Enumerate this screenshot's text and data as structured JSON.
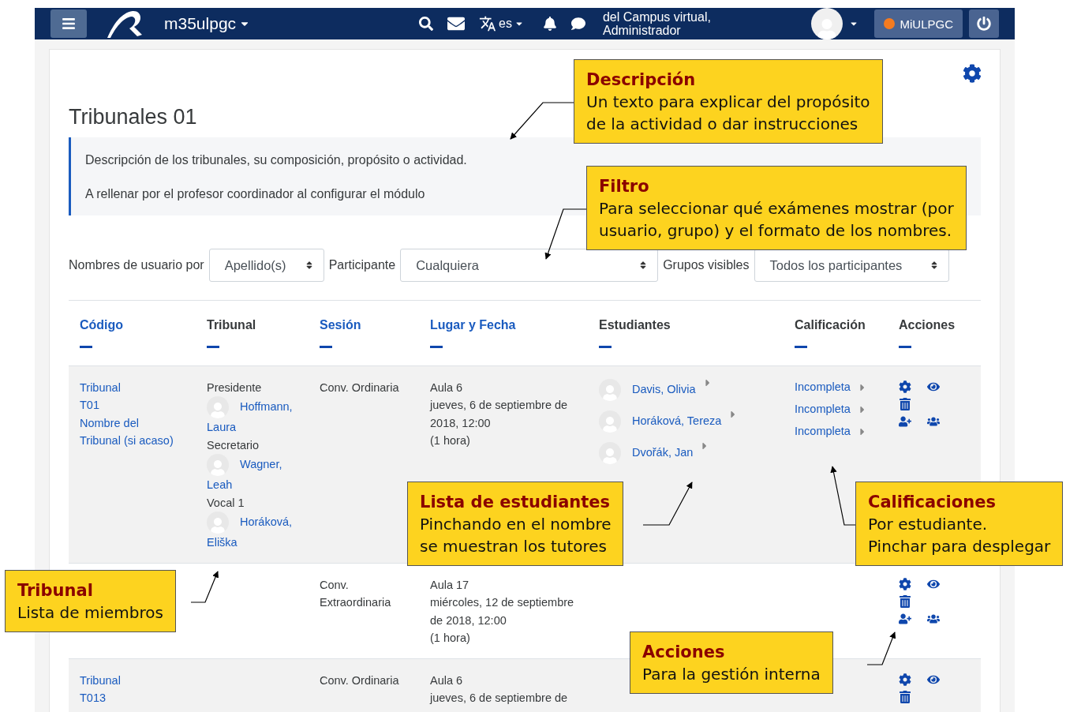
{
  "navbar": {
    "site_name": "m35ulpgc",
    "language": "es",
    "user_lines": [
      "del Campus virtual,",
      "Administrador"
    ],
    "portal_button": "MiULPGC"
  },
  "page": {
    "title": "Tribunales 01",
    "description": [
      "Descripción de los tribunales, su composición, propósito o actividad.",
      "A rellenar por el profesor coordinador al configurar el módulo"
    ]
  },
  "filters": [
    {
      "label": "Nombres de usuario por",
      "value": "Apellido(s)"
    },
    {
      "label": "Participante",
      "value": "Cualquiera"
    },
    {
      "label": "Grupos visibles",
      "value": "Todos los participantes"
    }
  ],
  "table": {
    "columns": [
      {
        "label": "Código",
        "link": true
      },
      {
        "label": "Tribunal",
        "link": false
      },
      {
        "label": "Sesión",
        "link": true
      },
      {
        "label": "Lugar y Fecha",
        "link": true
      },
      {
        "label": "Estudiantes",
        "link": false
      },
      {
        "label": "Calificación",
        "link": false
      },
      {
        "label": "Acciones",
        "link": false
      }
    ],
    "rows": [
      {
        "code": [
          "Tribunal",
          "T01",
          "Nombre del",
          "Tribunal (si acaso)"
        ],
        "members": [
          {
            "role": "Presidente",
            "name": "Hoffmann, Laura"
          },
          {
            "role": "Secretario",
            "name": "Wagner, Leah"
          },
          {
            "role": "Vocal 1",
            "name": "Horáková, Eliška"
          }
        ],
        "session": [
          "Conv. Ordinaria"
        ],
        "place": [
          "Aula 6",
          "jueves, 6 de septiembre de 2018, 12:00",
          "(1 hora)"
        ],
        "students": [
          "Davis, Olivia",
          "Horáková, Tereza",
          "Dvořák, Jan"
        ],
        "grades": [
          "Incompleta",
          "Incompleta",
          "Incompleta"
        ],
        "actions": [
          {
            "kind": "settings"
          },
          {
            "kind": "view"
          },
          {
            "kind": "delete"
          },
          {
            "kind": "add-user"
          },
          {
            "kind": "group"
          }
        ]
      },
      {
        "code": [],
        "members": [],
        "session": [
          "Conv.",
          "Extraordinaria"
        ],
        "place": [
          "Aula 17",
          "miércoles, 12 de septiembre de 2018, 12:00",
          "(1 hora)"
        ],
        "students": [],
        "grades": [],
        "actions": [
          {
            "kind": "settings"
          },
          {
            "kind": "view"
          },
          {
            "kind": "delete"
          },
          {
            "kind": "add-user"
          },
          {
            "kind": "group"
          }
        ]
      },
      {
        "code": [
          "Tribunal",
          "T013"
        ],
        "members": [],
        "session": [
          "Conv. Ordinaria"
        ],
        "place": [
          "Aula 6",
          "jueves, 6 de septiembre de"
        ],
        "students": [],
        "grades": [],
        "actions": [
          {
            "kind": "settings"
          },
          {
            "kind": "view"
          },
          {
            "kind": "delete"
          }
        ]
      }
    ]
  },
  "annotations": [
    {
      "title": "Descripción",
      "lines": [
        "Un texto para explicar del propósito",
        "de la actividad o dar instrucciones"
      ]
    },
    {
      "title": "Filtro",
      "lines": [
        "Para seleccionar qué exámenes mostrar (por",
        "usuario, grupo) y el formato de los nombres."
      ]
    },
    {
      "title": "Lista de estudiantes",
      "lines": [
        "Pinchando en el nombre",
        "se muestran los tutores"
      ]
    },
    {
      "title": "Calificaciones",
      "lines": [
        "Por estudiante.",
        "Pinchar para desplegar"
      ]
    },
    {
      "title": "Tribunal",
      "lines": [
        "Lista de miembros"
      ]
    },
    {
      "title": "Acciones",
      "lines": [
        "Para la gestión interna"
      ]
    }
  ]
}
